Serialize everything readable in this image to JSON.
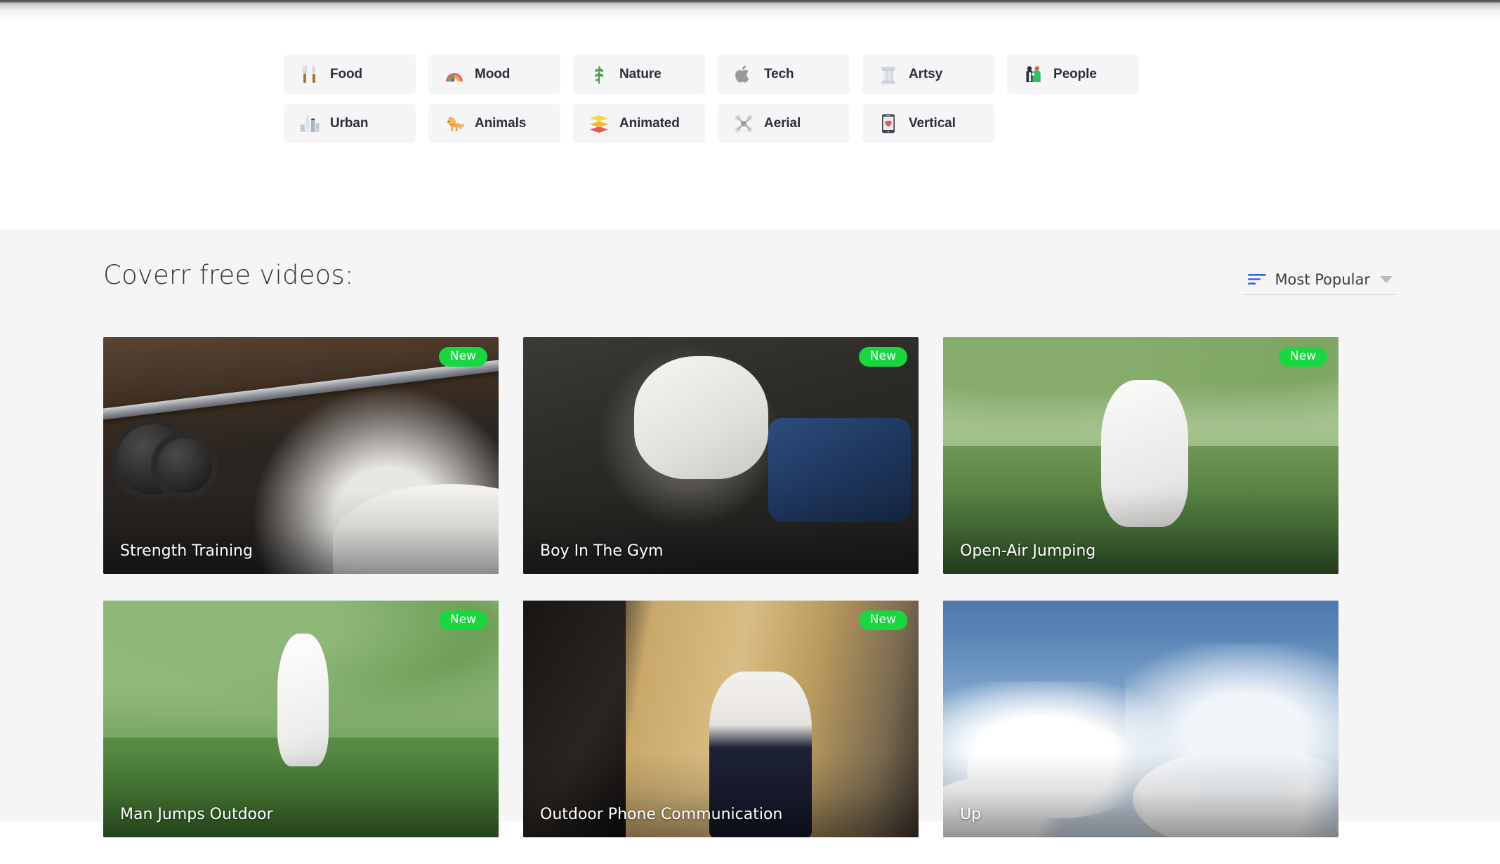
{
  "categories": {
    "rows": [
      [
        {
          "label": "Food",
          "icon": "fork-knife-icon"
        },
        {
          "label": "Mood",
          "icon": "rainbow-icon"
        },
        {
          "label": "Nature",
          "icon": "herb-leaf-icon"
        },
        {
          "label": "Tech",
          "icon": "apple-icon"
        },
        {
          "label": "Artsy",
          "icon": "classical-column-icon"
        },
        {
          "label": "People",
          "icon": "couple-icon"
        }
      ],
      [
        {
          "label": "Urban",
          "icon": "cityscape-icon"
        },
        {
          "label": "Animals",
          "icon": "dog-icon"
        },
        {
          "label": "Animated",
          "icon": "layers-icon"
        },
        {
          "label": "Aerial",
          "icon": "drone-icon"
        },
        {
          "label": "Vertical",
          "icon": "mobile-heart-icon"
        }
      ]
    ]
  },
  "videos_section": {
    "title": "Coverr free videos:",
    "sort": {
      "icon": "sort-lines-icon",
      "label": "Most Popular",
      "caret": "chevron-down-icon"
    },
    "badge_new": "New",
    "rows": [
      [
        {
          "title": "Strength Training",
          "badge": "New",
          "scene": "sc-gym1"
        },
        {
          "title": "Boy In The Gym",
          "badge": "New",
          "scene": "sc-gym2"
        },
        {
          "title": "Open-Air Jumping",
          "badge": "New",
          "scene": "sc-park1"
        }
      ],
      [
        {
          "title": "Man Jumps Outdoor",
          "badge": "New",
          "scene": "sc-park2"
        },
        {
          "title": "Outdoor Phone Communication",
          "badge": "New",
          "scene": "sc-street"
        },
        {
          "title": "Up",
          "badge": "",
          "scene": "sc-sky"
        }
      ]
    ]
  },
  "colors": {
    "badge_green": "#18d741",
    "chip_bg": "#f5f5f7",
    "section_bg": "#f5f5f5",
    "sort_icon_blue": "#2f6bdd",
    "text_dark": "#2d2f35"
  }
}
